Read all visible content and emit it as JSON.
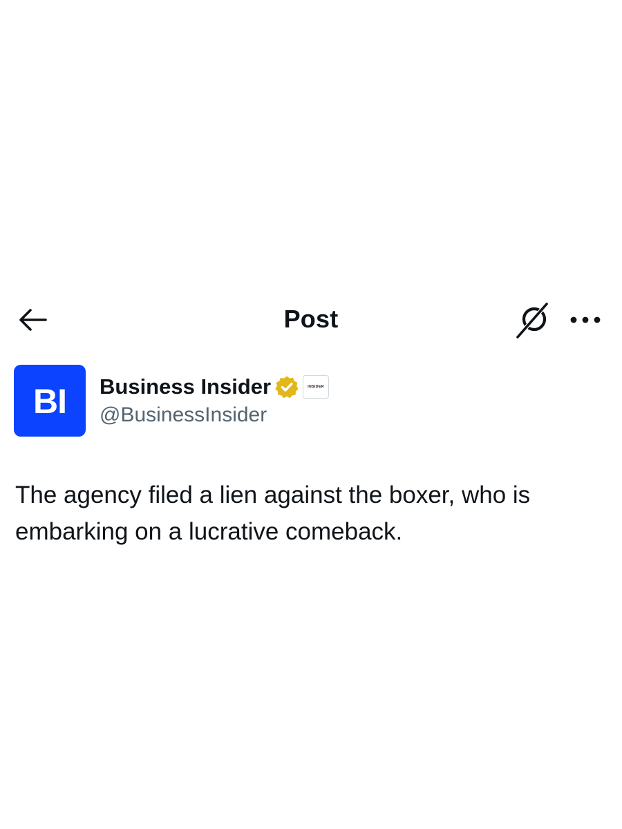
{
  "header": {
    "title": "Post",
    "back_icon": "arrow-left-icon",
    "grok_icon": "grok-icon",
    "more_icon": "more-horizontal-icon"
  },
  "author": {
    "avatar_text": "BI",
    "avatar_color": "#0b43ff",
    "display_name": "Business Insider",
    "verified_badge_icon": "verified-gold-badge-icon",
    "verified_color": "#e2b719",
    "affiliate_badge_text": "INSIDER",
    "handle": "@BusinessInsider"
  },
  "post": {
    "text": "The agency filed a lien against the boxer, who is embarking on a lucrative comeback."
  }
}
